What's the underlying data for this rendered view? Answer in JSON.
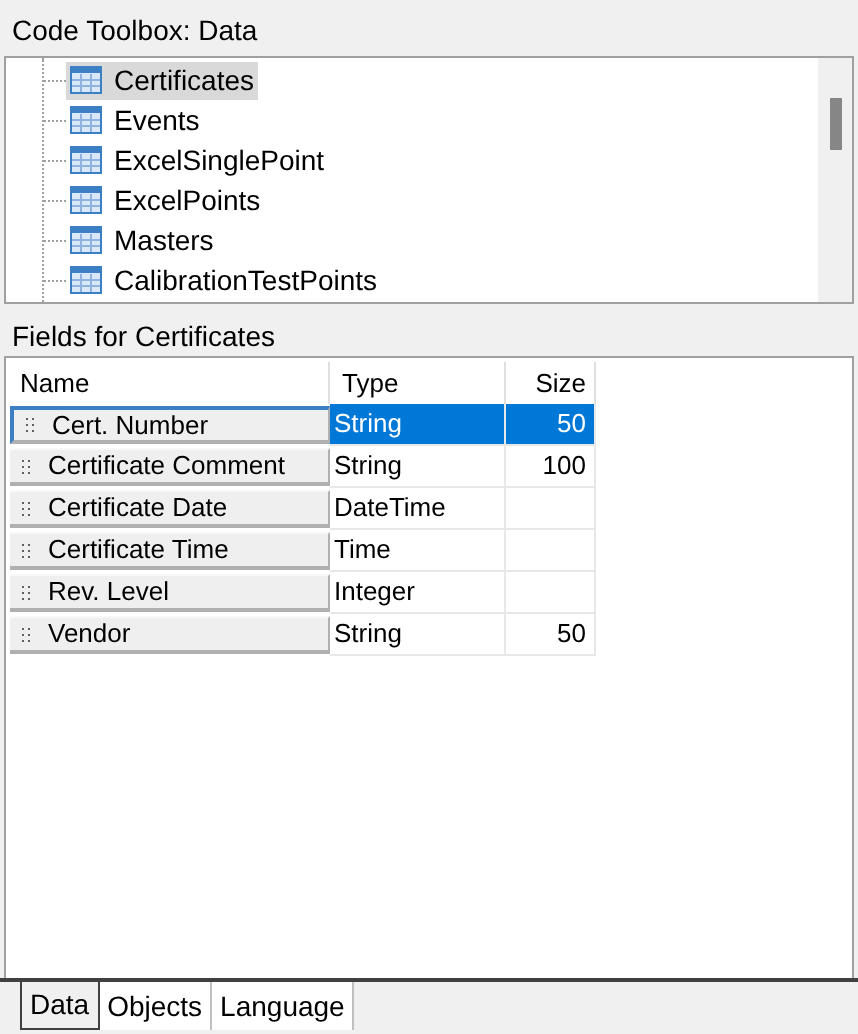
{
  "title": "Code Toolbox: Data",
  "tree": {
    "items": [
      {
        "label": "Certificates",
        "selected": true
      },
      {
        "label": "Events",
        "selected": false
      },
      {
        "label": "ExcelSinglePoint",
        "selected": false
      },
      {
        "label": "ExcelPoints",
        "selected": false
      },
      {
        "label": "Masters",
        "selected": false
      },
      {
        "label": "CalibrationTestPoints",
        "selected": false
      }
    ]
  },
  "fields": {
    "title": "Fields for Certificates",
    "columns": [
      "Name",
      "Type",
      "Size"
    ],
    "rows": [
      {
        "name": "Cert. Number",
        "type": "String",
        "size": "50",
        "selected": true
      },
      {
        "name": "Certificate Comment",
        "type": "String",
        "size": "100",
        "selected": false
      },
      {
        "name": "Certificate Date",
        "type": "DateTime",
        "selected": false
      },
      {
        "name": "Certificate Time",
        "type": "Time",
        "selected": false
      },
      {
        "name": "Rev. Level",
        "type": "Integer",
        "selected": false
      },
      {
        "name": "Vendor",
        "type": "String",
        "size": "50",
        "selected": false
      }
    ]
  },
  "tabs": [
    {
      "label": "Data",
      "selected": true
    },
    {
      "label": "Objects",
      "selected": false
    },
    {
      "label": "Language",
      "selected": false
    }
  ]
}
